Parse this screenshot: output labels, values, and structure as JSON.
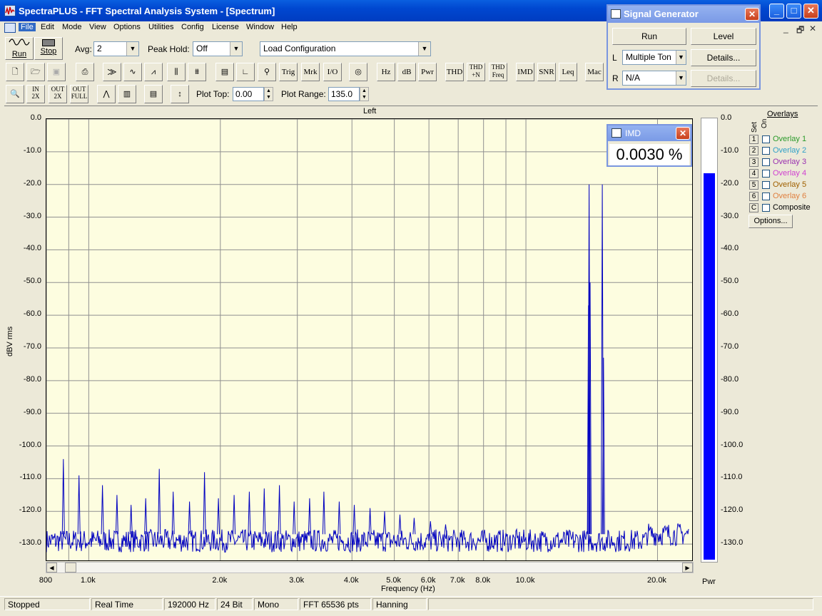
{
  "window": {
    "title": "SpectraPLUS - FFT Spectral Analysis System - [Spectrum]"
  },
  "menu": [
    "File",
    "Edit",
    "Mode",
    "View",
    "Options",
    "Utilities",
    "Config",
    "License",
    "Window",
    "Help"
  ],
  "toolbar1": {
    "run_label": "Run",
    "stop_label": "Stop",
    "avg_label": "Avg:",
    "avg_value": "2",
    "peak_hold_label": "Peak Hold:",
    "peak_hold_value": "Off",
    "config_value": "Load Configuration"
  },
  "toolbar2": {
    "buttons": [
      "Trig",
      "Mrk",
      "I/O",
      "Hz",
      "dB",
      "Pwr",
      "THD",
      "THD +N",
      "THD Freq",
      "IMD",
      "SNR",
      "Leq",
      "Mac"
    ]
  },
  "toolbar3": {
    "plot_top_label": "Plot Top:",
    "plot_top_value": "0.00",
    "plot_range_label": "Plot Range:",
    "plot_range_value": "135.0"
  },
  "signal_generator": {
    "title": "Signal Generator",
    "run_label": "Run",
    "level_label": "Level",
    "left_label": "L",
    "left_value": "Multiple Ton",
    "left_details": "Details...",
    "right_label": "R",
    "right_value": "N/A",
    "right_details": "Details..."
  },
  "imd_readout": {
    "title": "IMD",
    "value": "0.0030 %"
  },
  "overlays": {
    "title": "Overlays",
    "set_label": "Set",
    "on_label": "On",
    "items": [
      {
        "num": "1",
        "label": "Overlay 1",
        "color": "#2a9a2a"
      },
      {
        "num": "2",
        "label": "Overlay 2",
        "color": "#30a0c8"
      },
      {
        "num": "3",
        "label": "Overlay 3",
        "color": "#9a30b0"
      },
      {
        "num": "4",
        "label": "Overlay 4",
        "color": "#d040d0"
      },
      {
        "num": "5",
        "label": "Overlay 5",
        "color": "#a06000"
      },
      {
        "num": "6",
        "label": "Overlay 6",
        "color": "#e08040"
      },
      {
        "num": "C",
        "label": "Composite",
        "color": "#000000"
      }
    ],
    "options_label": "Options..."
  },
  "meter": {
    "label": "Pwr",
    "level_db": -16.5
  },
  "status": [
    "Stopped",
    "Real Time",
    "192000 Hz",
    "24 Bit",
    "Mono",
    "FFT 65536 pts",
    "Hanning"
  ],
  "chart_data": {
    "type": "line",
    "title": "Left",
    "xlabel": "Frequency (Hz)",
    "ylabel": "dBV rms",
    "x_scale": "log",
    "xlim": [
      800,
      24000
    ],
    "ylim": [
      -135,
      0
    ],
    "y_ticks": [
      "0.0",
      "-10.0",
      "-20.0",
      "-30.0",
      "-40.0",
      "-50.0",
      "-60.0",
      "-70.0",
      "-80.0",
      "-90.0",
      "-100.0",
      "-110.0",
      "-120.0",
      "-130.0"
    ],
    "x_tick_labels": [
      "800",
      "1.0k",
      "2.0k",
      "3.0k",
      "4.0k",
      "5.0k",
      "6.0k",
      "7.0k",
      "8.0k",
      "10.0k",
      "20.0k"
    ],
    "x_ticks": [
      800,
      1000,
      2000,
      3000,
      4000,
      5000,
      6000,
      7000,
      8000,
      10000,
      20000
    ],
    "grid": true,
    "noise_floor_db": -129,
    "peaks": [
      {
        "x": 875,
        "y": -104
      },
      {
        "x": 950,
        "y": -109
      },
      {
        "x": 1075,
        "y": -112
      },
      {
        "x": 1160,
        "y": -115
      },
      {
        "x": 1250,
        "y": -118
      },
      {
        "x": 1350,
        "y": -116
      },
      {
        "x": 1450,
        "y": -107
      },
      {
        "x": 1560,
        "y": -114
      },
      {
        "x": 1700,
        "y": -117
      },
      {
        "x": 1840,
        "y": -108
      },
      {
        "x": 1980,
        "y": -116
      },
      {
        "x": 2150,
        "y": -115
      },
      {
        "x": 2330,
        "y": -114
      },
      {
        "x": 2520,
        "y": -113
      },
      {
        "x": 2730,
        "y": -112
      },
      {
        "x": 2950,
        "y": -117
      },
      {
        "x": 3200,
        "y": -116
      },
      {
        "x": 3450,
        "y": -114
      },
      {
        "x": 3740,
        "y": -117
      },
      {
        "x": 4050,
        "y": -118
      },
      {
        "x": 4400,
        "y": -119
      },
      {
        "x": 4750,
        "y": -120
      },
      {
        "x": 5150,
        "y": -121
      },
      {
        "x": 5550,
        "y": -122
      },
      {
        "x": 6050,
        "y": -123
      },
      {
        "x": 6550,
        "y": -124
      },
      {
        "x": 13950,
        "y": -20
      },
      {
        "x": 13900,
        "y": -57
      },
      {
        "x": 14020,
        "y": -50
      },
      {
        "x": 14950,
        "y": -20
      },
      {
        "x": 15050,
        "y": -73
      }
    ]
  }
}
